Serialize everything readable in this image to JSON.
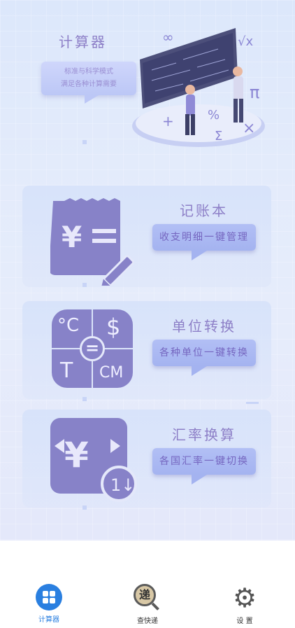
{
  "calculator": {
    "title": "计算器",
    "desc_line1": "标准与科学模式",
    "desc_line2": "满足各种计算需要"
  },
  "ledger": {
    "title": "记账本",
    "bubble": "收支明细一键管理",
    "icon": "yuan-receipt-pencil-icon"
  },
  "unit": {
    "title": "单位转换",
    "bubble": "各种单位一键转换",
    "icon_labels": [
      "°C",
      "$",
      "T",
      "CM"
    ]
  },
  "exchange": {
    "title": "汇率换算",
    "bubble": "各国汇率一键切换",
    "icon": "yuan-exchange-icon"
  },
  "tabs": [
    {
      "label": "计算器",
      "icon": "calculator-icon",
      "active": true
    },
    {
      "label": "查快递",
      "icon": "express-search-icon",
      "active": false
    },
    {
      "label": "设 置",
      "icon": "gear-icon",
      "active": false
    }
  ],
  "colors": {
    "accent": "#2a7fe0",
    "card_icon": "#8782c8",
    "title": "#8d7fc7"
  }
}
